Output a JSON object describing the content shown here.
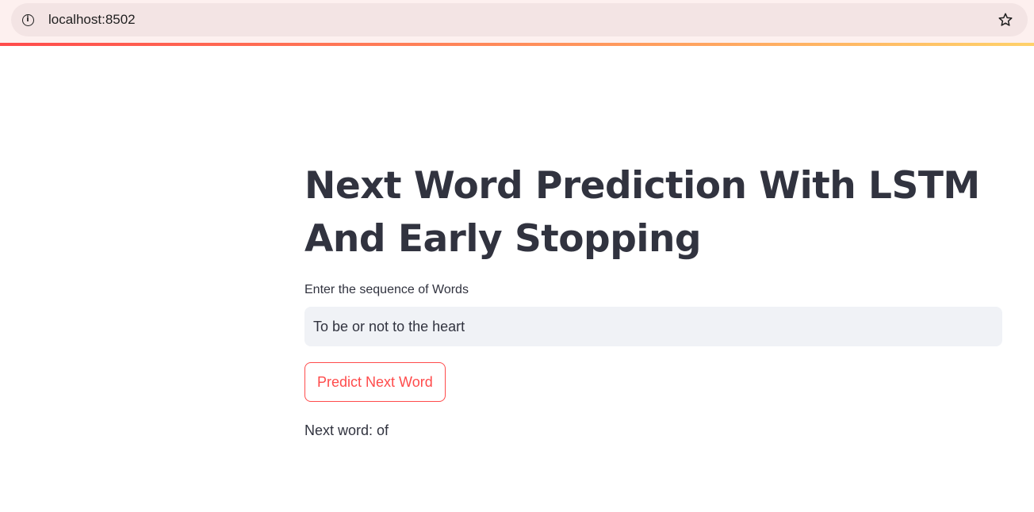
{
  "browser": {
    "url": "localhost:8502",
    "icons": {
      "site_info": "info-icon",
      "bookmark": "star-icon"
    },
    "progress_colors": [
      "#ff4b4b",
      "#ffd16a"
    ]
  },
  "app": {
    "title": "Next Word Prediction With LSTM And Early Stopping",
    "input": {
      "label": "Enter the sequence of Words",
      "value": "To be or not to the heart"
    },
    "button_label": "Predict Next Word",
    "result_text": "Next word: of"
  },
  "colors": {
    "accent": "#ff4b4b",
    "text": "#31333f",
    "input_bg": "#f0f2f6"
  }
}
